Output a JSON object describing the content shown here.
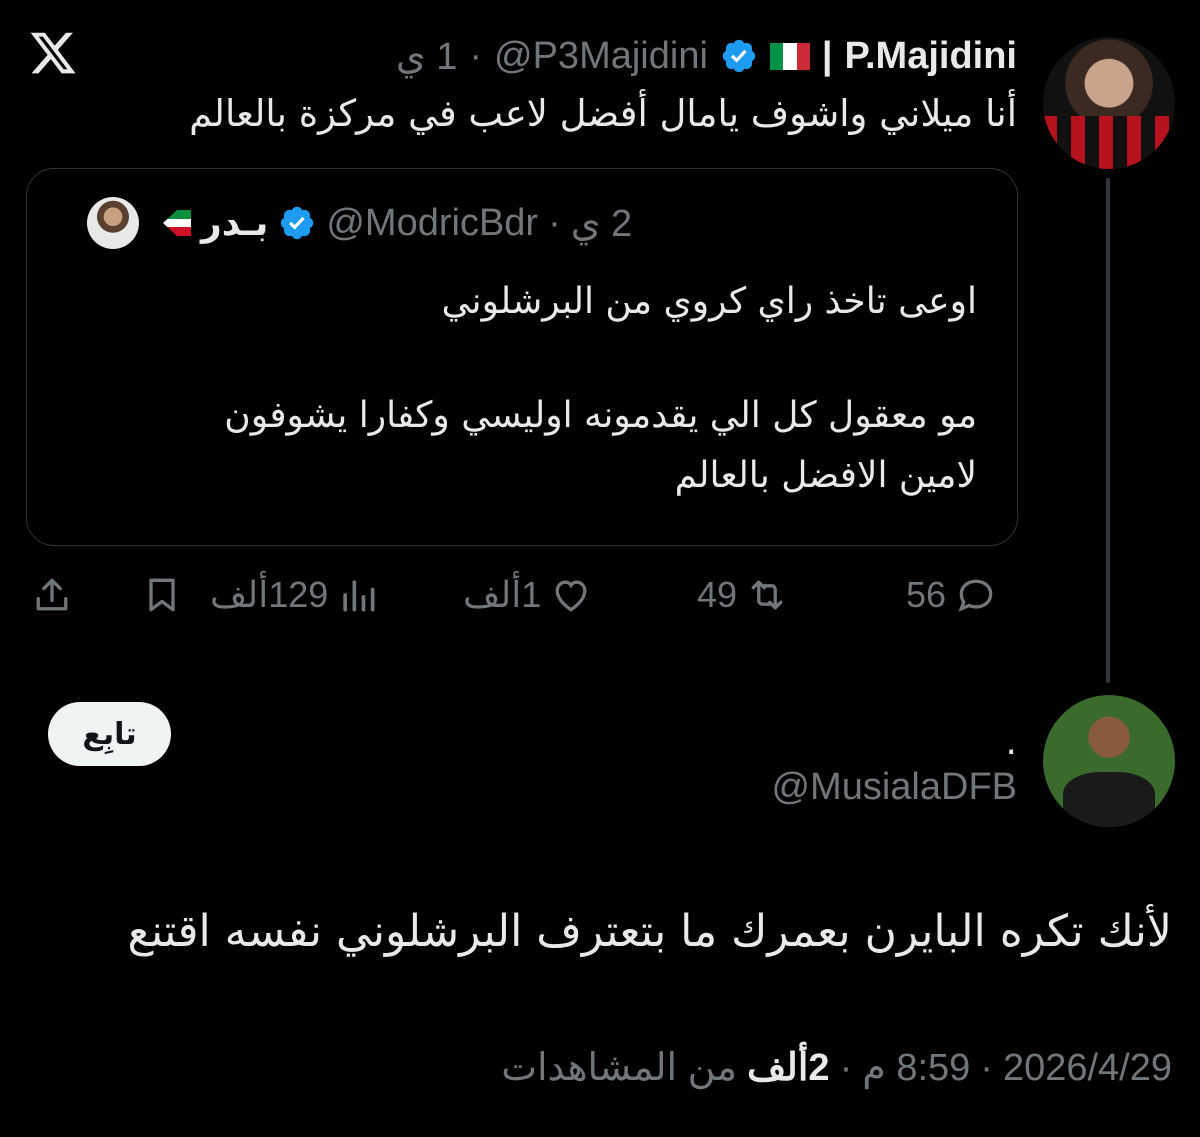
{
  "tweet": {
    "author_name": "P.Majidini",
    "separator": "|",
    "handle": "@P3Majidini",
    "time": "1 ي",
    "dot": "·",
    "text": "أنا ميلاني واشوف يامال أفضل لاعب في مركزة بالعالم"
  },
  "quote": {
    "author_name": "بـدر",
    "handle": "@ModricBdr",
    "time": "2 ي",
    "dot": "·",
    "lines": [
      "اوعى تاخذ راي كروي من البرشلوني",
      "مو معقول كل الي يقدمونه اوليسي وكفارا يشوفون",
      "لامين الافضل بالعالم"
    ]
  },
  "actions": {
    "replies": "56",
    "reposts": "49",
    "likes": "1ألف",
    "views": "129ألف"
  },
  "reply": {
    "follow_label": "تابِع",
    "name": ".",
    "handle": "@MusialaDFB",
    "text": "لأنك تكره البايرن بعمرك ما بتعترف البرشلوني نفسه اقتنع",
    "date": "2026/4/29",
    "time": "8:59 م",
    "views_count": "2ألف",
    "views_label": "من المشاهدات",
    "dot": "·"
  },
  "colors": {
    "background": "#000000",
    "text": "#e7e9ea",
    "muted": "#71767b",
    "verified": "#1d9bf0",
    "border": "#2f3336"
  },
  "icons": [
    "x-logo-icon",
    "verified-icon",
    "italy-flag-icon",
    "kuwait-flag-icon",
    "reply-icon",
    "repost-icon",
    "like-icon",
    "views-icon",
    "bookmark-icon",
    "share-icon"
  ]
}
